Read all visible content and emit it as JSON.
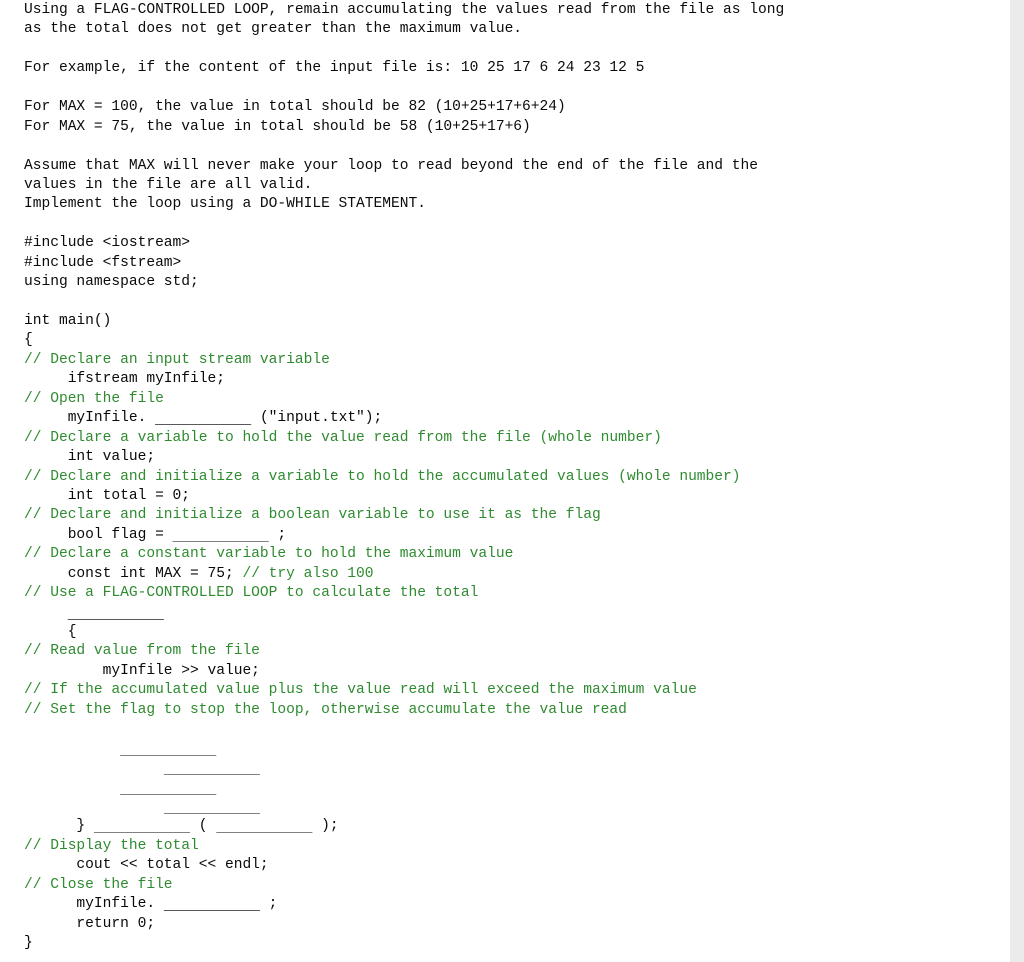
{
  "document": {
    "kind": "programming-exercise",
    "language": "C++",
    "colors": {
      "background": "#ffffff",
      "text": "#000000",
      "comment_green": "#2f8b30",
      "scrollbar_track": "#ebebeb",
      "blank_rule": "#595959"
    }
  },
  "problem_statement": {
    "lines": [
      "Using a FLAG-CONTROLLED LOOP, remain accumulating the values read from the file as long",
      "as the total does not get greater than the maximum value.",
      "",
      "For example, if the content of the input file is: 10 25 17 6 24 23 12 5",
      "",
      "For MAX = 100, the value in total should be 82 (10+25+17+6+24)",
      "For MAX = 75, the value in total should be 58 (10+25+17+6)",
      "",
      "Assume that MAX will never make your loop to read beyond the end of the file and the",
      "values in the file are all valid.",
      "Implement the loop using a DO-WHILE STATEMENT."
    ],
    "example_input_values": [
      10,
      25,
      17,
      6,
      24,
      23,
      12,
      5
    ],
    "cases": [
      {
        "max": 100,
        "expected_total": 82,
        "expression": "(10+25+17+6+24)"
      },
      {
        "max": 75,
        "expected_total": 58,
        "expression": "(10+25+17+6)"
      }
    ]
  },
  "code": {
    "lines": [
      {
        "id": "include-iostream",
        "type": "code",
        "text": "#include <iostream>"
      },
      {
        "id": "include-fstream",
        "type": "code",
        "text": "#include <fstream>"
      },
      {
        "id": "using-namespace",
        "type": "code",
        "text": "using namespace std;"
      },
      {
        "id": "spacer-1",
        "type": "blank",
        "text": ""
      },
      {
        "id": "main-signature",
        "type": "code",
        "text": "int main()"
      },
      {
        "id": "main-open-brace",
        "type": "code",
        "text": "{"
      },
      {
        "id": "comment-declare-stream",
        "type": "comment",
        "text": "// Declare an input stream variable"
      },
      {
        "id": "declare-ifstream",
        "type": "code",
        "text": "     ifstream myInfile;"
      },
      {
        "id": "comment-open-file",
        "type": "comment",
        "text": "// Open the file"
      },
      {
        "id": "open-file",
        "type": "mixed",
        "prefix": "     myInfile. ",
        "blank": "___________",
        "suffix": " (\"input.txt\");"
      },
      {
        "id": "comment-declare-value",
        "type": "comment",
        "text": "// Declare a variable to hold the value read from the file (whole number)"
      },
      {
        "id": "declare-value",
        "type": "code",
        "text": "     int value;"
      },
      {
        "id": "comment-declare-total",
        "type": "comment",
        "text": "// Declare and initialize a variable to hold the accumulated values (whole number)"
      },
      {
        "id": "declare-total",
        "type": "code",
        "text": "     int total = 0;"
      },
      {
        "id": "comment-declare-flag",
        "type": "comment",
        "text": "// Declare and initialize a boolean variable to use it as the flag"
      },
      {
        "id": "declare-flag",
        "type": "mixed",
        "prefix": "     bool flag = ",
        "blank": "___________",
        "suffix": " ;"
      },
      {
        "id": "comment-declare-max",
        "type": "comment",
        "text": "// Declare a constant variable to hold the maximum value"
      },
      {
        "id": "declare-max",
        "type": "code-with-trailing-comment",
        "code_text": "     const int MAX = 75; ",
        "comment_text": "// try also 100"
      },
      {
        "id": "comment-use-flag-loop",
        "type": "comment",
        "text": "// Use a FLAG-CONTROLLED LOOP to calculate the total"
      },
      {
        "id": "loop-keyword-blank",
        "type": "blank-only",
        "indent": "     ",
        "blank": "___________"
      },
      {
        "id": "loop-open-brace",
        "type": "code",
        "text": "     {"
      },
      {
        "id": "comment-read-value",
        "type": "comment",
        "text": "// Read value from the file"
      },
      {
        "id": "read-value",
        "type": "code",
        "text": "         myInfile >> value;"
      },
      {
        "id": "comment-if-exceed",
        "type": "comment",
        "text": "// If the accumulated value plus the value read will exceed the maximum value"
      },
      {
        "id": "comment-set-flag",
        "type": "comment",
        "text": "// Set the flag to stop the loop, otherwise accumulate the value read"
      },
      {
        "id": "body-spacer",
        "type": "blank",
        "text": ""
      },
      {
        "id": "body-blank-1",
        "type": "blank-only",
        "indent": "           ",
        "blank": "___________"
      },
      {
        "id": "body-blank-2",
        "type": "blank-only",
        "indent": "                ",
        "blank": "___________"
      },
      {
        "id": "body-blank-3",
        "type": "blank-only",
        "indent": "           ",
        "blank": "___________"
      },
      {
        "id": "body-blank-4",
        "type": "blank-only",
        "indent": "                ",
        "blank": "___________"
      },
      {
        "id": "loop-close-while",
        "type": "while-line",
        "prefix": "      } ",
        "blank1": "___________",
        "middle": " ( ",
        "blank2": "___________",
        "suffix": " );"
      },
      {
        "id": "comment-display-total",
        "type": "comment",
        "text": "// Display the total"
      },
      {
        "id": "display-total",
        "type": "code",
        "text": "      cout << total << endl;"
      },
      {
        "id": "comment-close-file",
        "type": "comment",
        "text": "// Close the file"
      },
      {
        "id": "close-file",
        "type": "mixed",
        "prefix": "      myInfile. ",
        "blank": "___________",
        "suffix": " ;"
      },
      {
        "id": "return-zero",
        "type": "code",
        "text": "      return 0;"
      },
      {
        "id": "main-close-brace",
        "type": "code",
        "text": "}"
      }
    ]
  }
}
